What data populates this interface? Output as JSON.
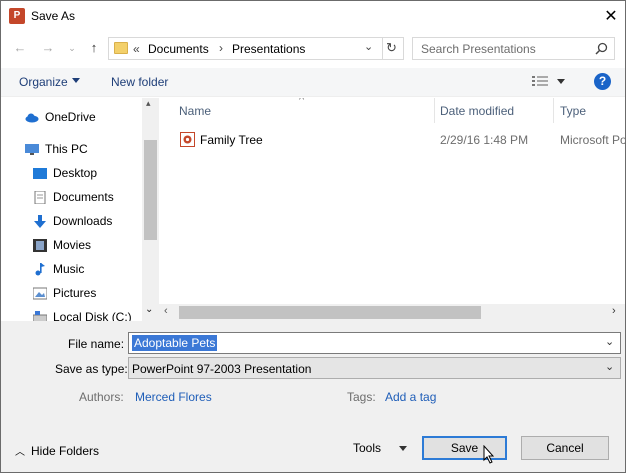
{
  "window": {
    "title": "Save As",
    "app_icon": "powerpoint-icon"
  },
  "address_bar": {
    "overflow": "«",
    "crumbs": [
      "Documents",
      "Presentations"
    ],
    "refresh_icon": "refresh-icon"
  },
  "search": {
    "placeholder": "Search Presentations"
  },
  "toolbar": {
    "organize_label": "Organize",
    "new_folder_label": "New folder",
    "help_label": "?"
  },
  "nav_pane": {
    "items": [
      {
        "label": "OneDrive",
        "icon": "cloud-icon"
      },
      {
        "label": "This PC",
        "icon": "computer-icon"
      },
      {
        "label": "Desktop",
        "icon": "desktop-icon"
      },
      {
        "label": "Documents",
        "icon": "documents-icon"
      },
      {
        "label": "Downloads",
        "icon": "download-icon"
      },
      {
        "label": "Movies",
        "icon": "film-icon"
      },
      {
        "label": "Music",
        "icon": "music-note-icon"
      },
      {
        "label": "Pictures",
        "icon": "pictures-icon"
      },
      {
        "label": "Local Disk (C:)",
        "icon": "drive-icon"
      }
    ]
  },
  "file_list": {
    "columns": [
      "Name",
      "Date modified",
      "Type"
    ],
    "rows": [
      {
        "name": "Family Tree",
        "date": "2/29/16 1:48 PM",
        "type": "Microsoft Po",
        "icon": "pptx-file-icon"
      }
    ]
  },
  "form": {
    "file_name_label": "File name:",
    "file_name_value": "Adoptable Pets",
    "save_type_label": "Save as type:",
    "save_type_value": "PowerPoint 97-2003 Presentation",
    "authors_label": "Authors:",
    "authors_value": "Merced Flores",
    "tags_label": "Tags:",
    "tags_value": "Add a tag"
  },
  "footer": {
    "hide_folders_label": "Hide Folders",
    "tools_label": "Tools",
    "save_label": "Save",
    "cancel_label": "Cancel"
  },
  "colors": {
    "accent": "#1a64c8",
    "selection": "#3b78d6",
    "link": "#1f5eb8",
    "folder": "#f3d06a"
  }
}
